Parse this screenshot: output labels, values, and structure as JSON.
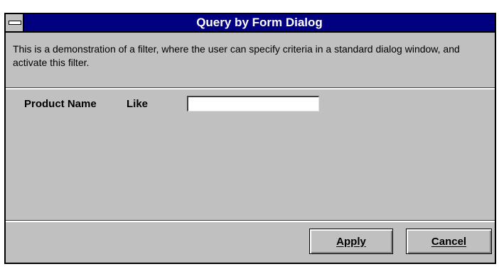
{
  "window": {
    "title": "Query by Form Dialog",
    "description": "This is a demonstration of a filter, where the user can specify criteria in a standard dialog window, and activate this filter."
  },
  "form": {
    "field_label": "Product Name",
    "operator_label": "Like",
    "input_value": ""
  },
  "buttons": {
    "apply": "Apply",
    "cancel": "Cancel"
  },
  "colors": {
    "titlebar": "#000080",
    "dialog_face": "#c0c0c0"
  },
  "icons": {
    "system_menu": "window-system-menu-icon"
  }
}
